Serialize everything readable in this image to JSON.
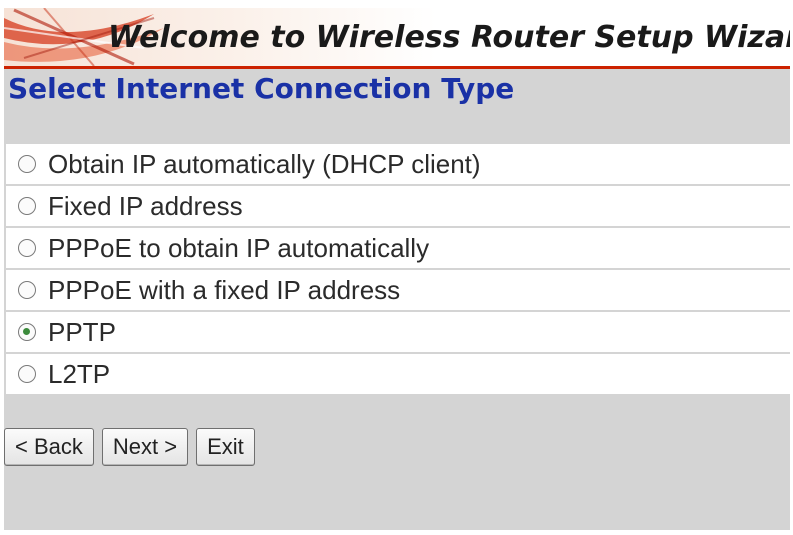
{
  "banner": {
    "title": "Welcome to Wireless Router Setup Wizard"
  },
  "section": {
    "title": "Select Internet Connection Type"
  },
  "options": [
    {
      "label": "Obtain IP automatically (DHCP client)",
      "selected": false
    },
    {
      "label": "Fixed IP address",
      "selected": false
    },
    {
      "label": "PPPoE to obtain IP automatically",
      "selected": false
    },
    {
      "label": "PPPoE with a fixed IP address",
      "selected": false
    },
    {
      "label": "PPTP",
      "selected": true
    },
    {
      "label": "L2TP",
      "selected": false
    }
  ],
  "buttons": {
    "back": "< Back",
    "next": "Next >",
    "exit": "Exit"
  },
  "colors": {
    "accent": "#cc2200",
    "heading": "#1a31a6",
    "panel": "#d4d4d4",
    "radio_checked": "#3b8a3b"
  },
  "icons": {
    "banner_art": "red-swoosh-logo"
  }
}
